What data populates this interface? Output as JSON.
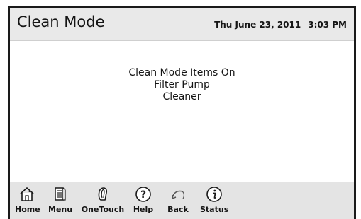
{
  "header": {
    "title": "Clean Mode",
    "date": "Thu June 23, 2011",
    "time": "3:03 PM"
  },
  "content": {
    "lines": [
      "Clean Mode Items On",
      "Filter Pump",
      "Cleaner"
    ]
  },
  "toolbar": {
    "buttons": [
      {
        "label": "Home",
        "icon": "home-icon"
      },
      {
        "label": "Menu",
        "icon": "menu-icon"
      },
      {
        "label": "OneTouch",
        "icon": "onetouch-icon"
      },
      {
        "label": "Help",
        "icon": "help-icon"
      },
      {
        "label": "Back",
        "icon": "back-icon"
      },
      {
        "label": "Status",
        "icon": "status-icon"
      }
    ]
  }
}
